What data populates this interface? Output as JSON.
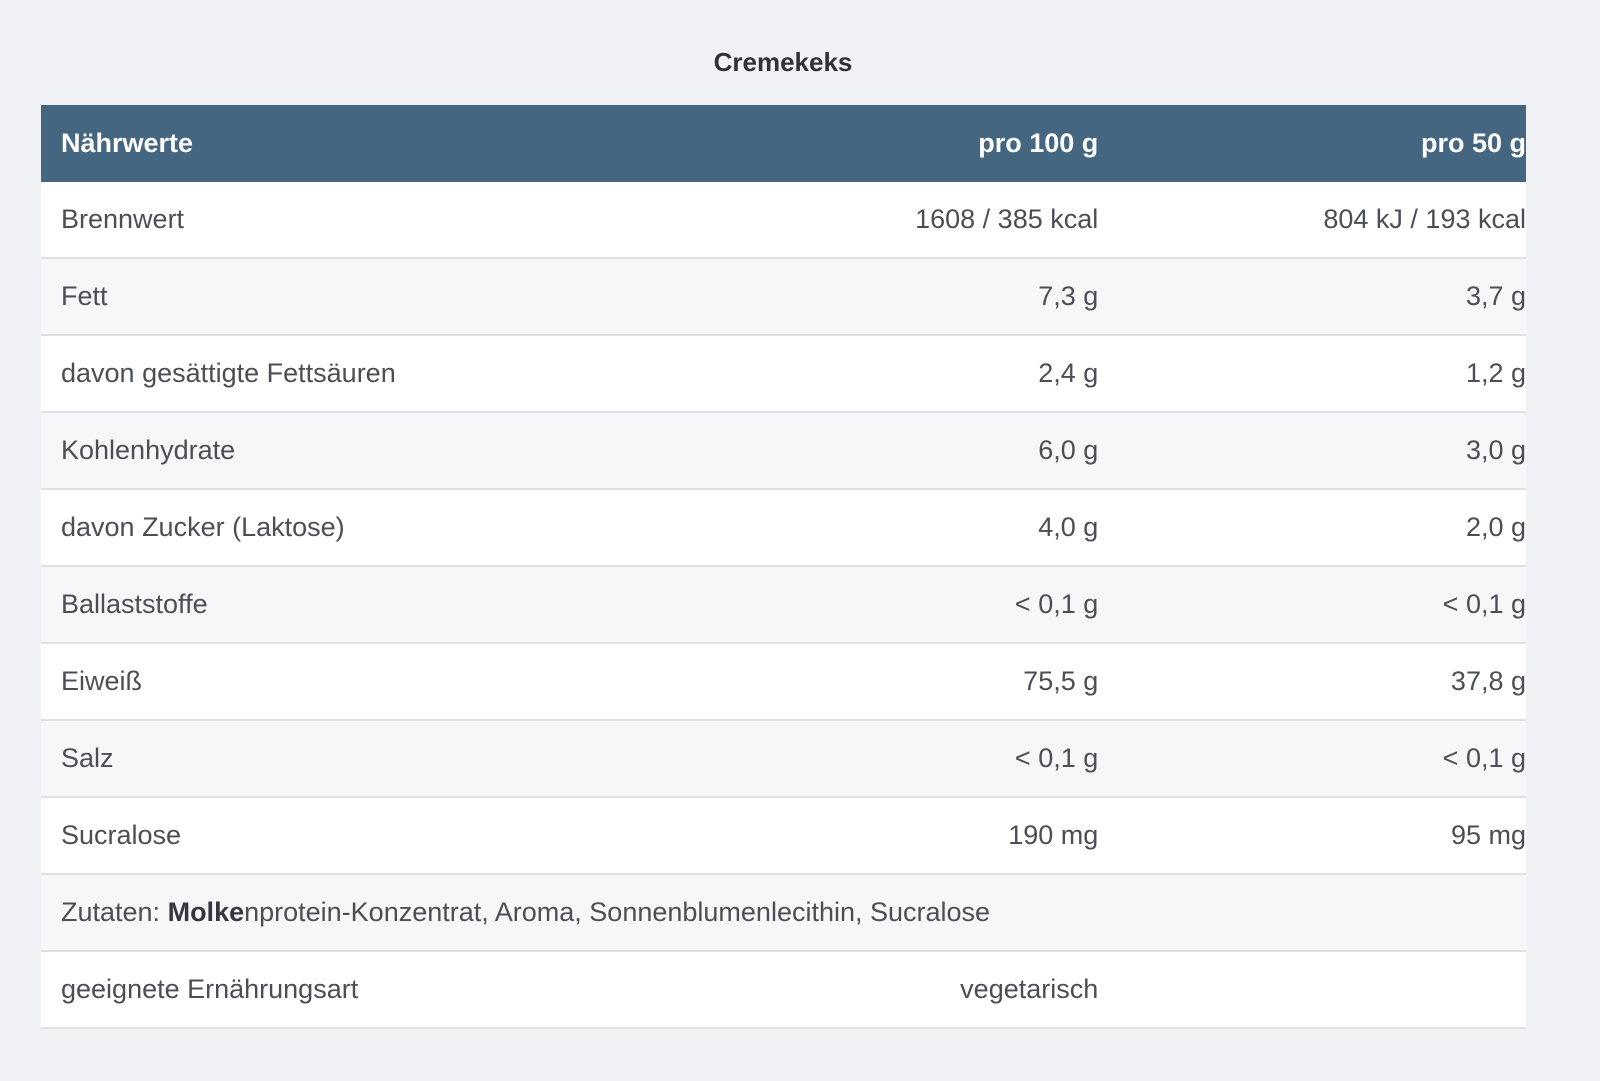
{
  "title": "Cremekeks",
  "table": {
    "headers": [
      "Nährwerte",
      "pro 100 g",
      "pro 50 g"
    ],
    "rows": [
      {
        "name": "Brennwert",
        "per100": "1608 / 385 kcal",
        "per50": "804 kJ / 193 kcal"
      },
      {
        "name": "Fett",
        "per100": "7,3 g",
        "per50": "3,7 g"
      },
      {
        "name": "davon gesättigte Fettsäuren",
        "per100": "2,4 g",
        "per50": "1,2 g"
      },
      {
        "name": "Kohlenhydrate",
        "per100": "6,0 g",
        "per50": "3,0 g"
      },
      {
        "name": "davon Zucker (Laktose)",
        "per100": "4,0 g",
        "per50": "2,0 g"
      },
      {
        "name": "Ballaststoffe",
        "per100": "< 0,1 g",
        "per50": "< 0,1 g"
      },
      {
        "name": "Eiweiß",
        "per100": "75,5 g",
        "per50": "37,8 g"
      },
      {
        "name": "Salz",
        "per100": "< 0,1 g",
        "per50": "< 0,1 g"
      },
      {
        "name": "Sucralose",
        "per100": "190 mg",
        "per50": "95 mg"
      }
    ]
  },
  "ingredients": {
    "label": "Zutaten: ",
    "bold": "Molke",
    "rest": "nprotein-Konzentrat, Aroma, Sonnenblumenlecithin, Sucralose"
  },
  "diet": {
    "label": "geeignete Ernährungsart",
    "value": "vegetarisch"
  }
}
